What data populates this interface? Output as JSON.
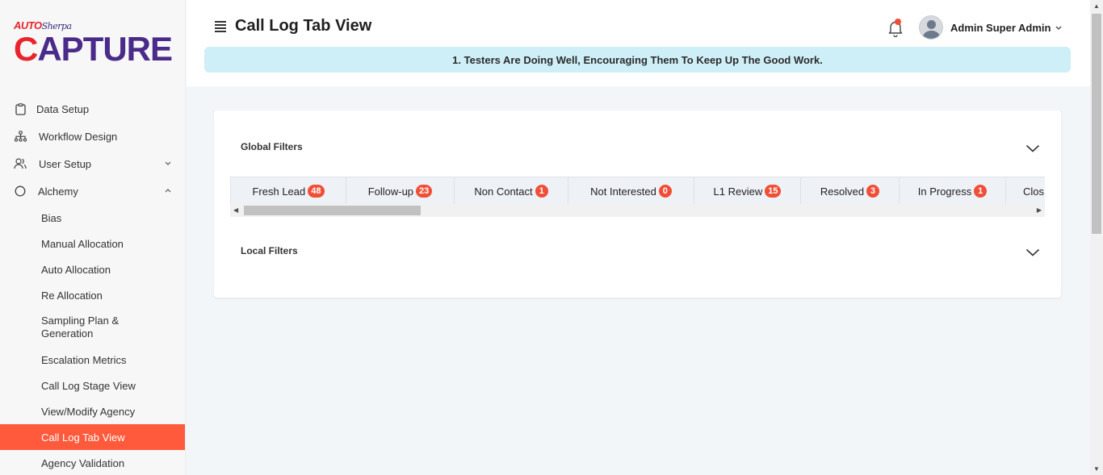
{
  "logo": {
    "brand_top": "AUTO",
    "brand_top_sub": "Sherpa",
    "brand_main_first": "C",
    "brand_main_rest": "APTURE"
  },
  "sidebar": {
    "items": [
      {
        "label": "Data Setup",
        "icon": "clipboard-icon"
      },
      {
        "label": "Workflow Design",
        "icon": "sitemap-icon"
      },
      {
        "label": "User Setup",
        "icon": "users-icon",
        "chevron": "chevron-down-icon"
      },
      {
        "label": "Alchemy",
        "icon": "circle-icon",
        "chevron": "chevron-up-icon"
      }
    ],
    "subitems": [
      {
        "label": "Bias"
      },
      {
        "label": "Manual Allocation"
      },
      {
        "label": "Auto Allocation"
      },
      {
        "label": "Re Allocation"
      },
      {
        "label": "Sampling Plan & Generation"
      },
      {
        "label": "Escalation Metrics"
      },
      {
        "label": "Call Log Stage View"
      },
      {
        "label": "View/Modify Agency"
      },
      {
        "label": "Call Log Tab View",
        "active": true
      },
      {
        "label": "Agency Validation"
      }
    ]
  },
  "header": {
    "title": "Call Log Tab View",
    "user_name": "Admin Super Admin",
    "banner": "1. Testers Are Doing Well, Encouraging Them To Keep Up The Good Work."
  },
  "filters": {
    "global_title": "Global Filters",
    "local_title": "Local Filters",
    "tabs": [
      {
        "label": "Fresh Lead",
        "count": "48"
      },
      {
        "label": "Follow-up",
        "count": "23"
      },
      {
        "label": "Non Contact",
        "count": "1"
      },
      {
        "label": "Not Interested",
        "count": "0"
      },
      {
        "label": "L1 Review",
        "count": "15"
      },
      {
        "label": "Resolved",
        "count": "3"
      },
      {
        "label": "In Progress",
        "count": "1"
      },
      {
        "label": "Clos",
        "count": ""
      }
    ]
  },
  "colors": {
    "accent": "#ff5a3c",
    "badge": "#f04e36",
    "banner_bg": "#cfeff8",
    "brand_purple": "#4a2b8a",
    "brand_red": "#e8242d"
  }
}
